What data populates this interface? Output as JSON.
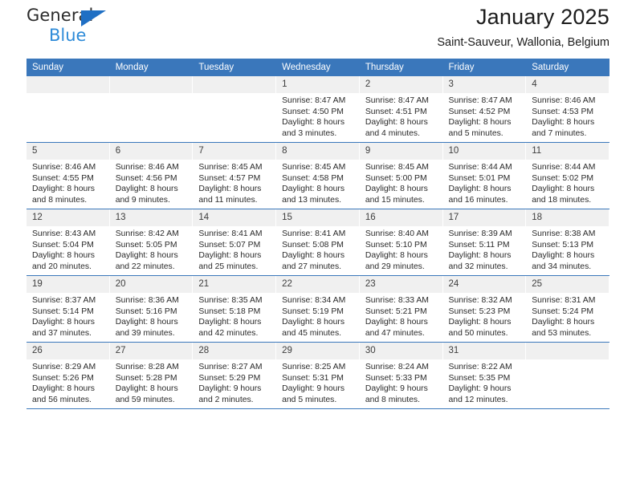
{
  "brand": {
    "name_top": "General",
    "name_bottom": "Blue",
    "accent_color": "#1f6fc4",
    "accent_color_light": "#2e8bd8"
  },
  "header": {
    "title": "January 2025",
    "subtitle": "Saint-Sauveur, Wallonia, Belgium"
  },
  "calendar": {
    "header_bg": "#3a77bb",
    "daynum_bg": "#f0f0f0",
    "weekdays": [
      "Sunday",
      "Monday",
      "Tuesday",
      "Wednesday",
      "Thursday",
      "Friday",
      "Saturday"
    ],
    "weeks": [
      [
        {
          "day": "",
          "empty": true
        },
        {
          "day": "",
          "empty": true
        },
        {
          "day": "",
          "empty": true
        },
        {
          "day": "1",
          "sunrise": "Sunrise: 8:47 AM",
          "sunset": "Sunset: 4:50 PM",
          "daylight_1": "Daylight: 8 hours",
          "daylight_2": "and 3 minutes."
        },
        {
          "day": "2",
          "sunrise": "Sunrise: 8:47 AM",
          "sunset": "Sunset: 4:51 PM",
          "daylight_1": "Daylight: 8 hours",
          "daylight_2": "and 4 minutes."
        },
        {
          "day": "3",
          "sunrise": "Sunrise: 8:47 AM",
          "sunset": "Sunset: 4:52 PM",
          "daylight_1": "Daylight: 8 hours",
          "daylight_2": "and 5 minutes."
        },
        {
          "day": "4",
          "sunrise": "Sunrise: 8:46 AM",
          "sunset": "Sunset: 4:53 PM",
          "daylight_1": "Daylight: 8 hours",
          "daylight_2": "and 7 minutes."
        }
      ],
      [
        {
          "day": "5",
          "sunrise": "Sunrise: 8:46 AM",
          "sunset": "Sunset: 4:55 PM",
          "daylight_1": "Daylight: 8 hours",
          "daylight_2": "and 8 minutes."
        },
        {
          "day": "6",
          "sunrise": "Sunrise: 8:46 AM",
          "sunset": "Sunset: 4:56 PM",
          "daylight_1": "Daylight: 8 hours",
          "daylight_2": "and 9 minutes."
        },
        {
          "day": "7",
          "sunrise": "Sunrise: 8:45 AM",
          "sunset": "Sunset: 4:57 PM",
          "daylight_1": "Daylight: 8 hours",
          "daylight_2": "and 11 minutes."
        },
        {
          "day": "8",
          "sunrise": "Sunrise: 8:45 AM",
          "sunset": "Sunset: 4:58 PM",
          "daylight_1": "Daylight: 8 hours",
          "daylight_2": "and 13 minutes."
        },
        {
          "day": "9",
          "sunrise": "Sunrise: 8:45 AM",
          "sunset": "Sunset: 5:00 PM",
          "daylight_1": "Daylight: 8 hours",
          "daylight_2": "and 15 minutes."
        },
        {
          "day": "10",
          "sunrise": "Sunrise: 8:44 AM",
          "sunset": "Sunset: 5:01 PM",
          "daylight_1": "Daylight: 8 hours",
          "daylight_2": "and 16 minutes."
        },
        {
          "day": "11",
          "sunrise": "Sunrise: 8:44 AM",
          "sunset": "Sunset: 5:02 PM",
          "daylight_1": "Daylight: 8 hours",
          "daylight_2": "and 18 minutes."
        }
      ],
      [
        {
          "day": "12",
          "sunrise": "Sunrise: 8:43 AM",
          "sunset": "Sunset: 5:04 PM",
          "daylight_1": "Daylight: 8 hours",
          "daylight_2": "and 20 minutes."
        },
        {
          "day": "13",
          "sunrise": "Sunrise: 8:42 AM",
          "sunset": "Sunset: 5:05 PM",
          "daylight_1": "Daylight: 8 hours",
          "daylight_2": "and 22 minutes."
        },
        {
          "day": "14",
          "sunrise": "Sunrise: 8:41 AM",
          "sunset": "Sunset: 5:07 PM",
          "daylight_1": "Daylight: 8 hours",
          "daylight_2": "and 25 minutes."
        },
        {
          "day": "15",
          "sunrise": "Sunrise: 8:41 AM",
          "sunset": "Sunset: 5:08 PM",
          "daylight_1": "Daylight: 8 hours",
          "daylight_2": "and 27 minutes."
        },
        {
          "day": "16",
          "sunrise": "Sunrise: 8:40 AM",
          "sunset": "Sunset: 5:10 PM",
          "daylight_1": "Daylight: 8 hours",
          "daylight_2": "and 29 minutes."
        },
        {
          "day": "17",
          "sunrise": "Sunrise: 8:39 AM",
          "sunset": "Sunset: 5:11 PM",
          "daylight_1": "Daylight: 8 hours",
          "daylight_2": "and 32 minutes."
        },
        {
          "day": "18",
          "sunrise": "Sunrise: 8:38 AM",
          "sunset": "Sunset: 5:13 PM",
          "daylight_1": "Daylight: 8 hours",
          "daylight_2": "and 34 minutes."
        }
      ],
      [
        {
          "day": "19",
          "sunrise": "Sunrise: 8:37 AM",
          "sunset": "Sunset: 5:14 PM",
          "daylight_1": "Daylight: 8 hours",
          "daylight_2": "and 37 minutes."
        },
        {
          "day": "20",
          "sunrise": "Sunrise: 8:36 AM",
          "sunset": "Sunset: 5:16 PM",
          "daylight_1": "Daylight: 8 hours",
          "daylight_2": "and 39 minutes."
        },
        {
          "day": "21",
          "sunrise": "Sunrise: 8:35 AM",
          "sunset": "Sunset: 5:18 PM",
          "daylight_1": "Daylight: 8 hours",
          "daylight_2": "and 42 minutes."
        },
        {
          "day": "22",
          "sunrise": "Sunrise: 8:34 AM",
          "sunset": "Sunset: 5:19 PM",
          "daylight_1": "Daylight: 8 hours",
          "daylight_2": "and 45 minutes."
        },
        {
          "day": "23",
          "sunrise": "Sunrise: 8:33 AM",
          "sunset": "Sunset: 5:21 PM",
          "daylight_1": "Daylight: 8 hours",
          "daylight_2": "and 47 minutes."
        },
        {
          "day": "24",
          "sunrise": "Sunrise: 8:32 AM",
          "sunset": "Sunset: 5:23 PM",
          "daylight_1": "Daylight: 8 hours",
          "daylight_2": "and 50 minutes."
        },
        {
          "day": "25",
          "sunrise": "Sunrise: 8:31 AM",
          "sunset": "Sunset: 5:24 PM",
          "daylight_1": "Daylight: 8 hours",
          "daylight_2": "and 53 minutes."
        }
      ],
      [
        {
          "day": "26",
          "sunrise": "Sunrise: 8:29 AM",
          "sunset": "Sunset: 5:26 PM",
          "daylight_1": "Daylight: 8 hours",
          "daylight_2": "and 56 minutes."
        },
        {
          "day": "27",
          "sunrise": "Sunrise: 8:28 AM",
          "sunset": "Sunset: 5:28 PM",
          "daylight_1": "Daylight: 8 hours",
          "daylight_2": "and 59 minutes."
        },
        {
          "day": "28",
          "sunrise": "Sunrise: 8:27 AM",
          "sunset": "Sunset: 5:29 PM",
          "daylight_1": "Daylight: 9 hours",
          "daylight_2": "and 2 minutes."
        },
        {
          "day": "29",
          "sunrise": "Sunrise: 8:25 AM",
          "sunset": "Sunset: 5:31 PM",
          "daylight_1": "Daylight: 9 hours",
          "daylight_2": "and 5 minutes."
        },
        {
          "day": "30",
          "sunrise": "Sunrise: 8:24 AM",
          "sunset": "Sunset: 5:33 PM",
          "daylight_1": "Daylight: 9 hours",
          "daylight_2": "and 8 minutes."
        },
        {
          "day": "31",
          "sunrise": "Sunrise: 8:22 AM",
          "sunset": "Sunset: 5:35 PM",
          "daylight_1": "Daylight: 9 hours",
          "daylight_2": "and 12 minutes."
        },
        {
          "day": "",
          "empty": true
        }
      ]
    ]
  }
}
